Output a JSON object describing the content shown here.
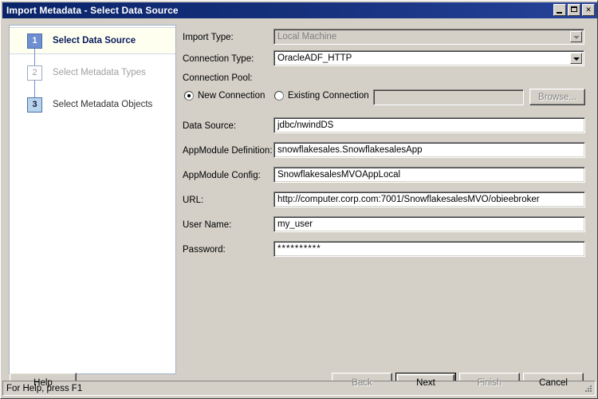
{
  "window": {
    "title": "Import Metadata - Select Data Source",
    "minimize_label": "Minimize",
    "maximize_label": "Maximize",
    "close_label": "✕"
  },
  "steps": [
    {
      "number": "1",
      "label": "Select Data Source",
      "state": "active"
    },
    {
      "number": "2",
      "label": "Select Metadata Types",
      "state": "disabled"
    },
    {
      "number": "3",
      "label": "Select Metadata Objects",
      "state": "pending"
    }
  ],
  "form": {
    "import_type": {
      "label": "Import Type:",
      "value": "Local Machine",
      "enabled": false
    },
    "connection_type": {
      "label": "Connection Type:",
      "value": "OracleADF_HTTP",
      "enabled": true
    },
    "connection_pool": {
      "label": "Connection Pool:",
      "new_connection_label": "New Connection",
      "existing_connection_label": "Existing Connection",
      "selected": "new",
      "existing_value": "",
      "browse_label": "Browse..."
    },
    "fields": [
      {
        "label": "Data Source:",
        "value": "jdbc/nwindDS"
      },
      {
        "label": "AppModule Definition:",
        "value": "snowflakesales.SnowflakesalesApp"
      },
      {
        "label": "AppModule Config:",
        "value": "SnowflakesalesMVOAppLocal"
      },
      {
        "label": "URL:",
        "value": "http://computer.corp.com:7001/SnowflakesalesMVO/obieebroker"
      },
      {
        "label": "User Name:",
        "value": "my_user"
      },
      {
        "label": "Password:",
        "value": "**********"
      }
    ]
  },
  "buttons": {
    "help": {
      "label": "Help",
      "enabled": true
    },
    "back": {
      "label": "Back",
      "enabled": false
    },
    "next": {
      "label": "Next",
      "enabled": true,
      "default": true
    },
    "finish": {
      "label": "Finish",
      "enabled": false
    },
    "cancel": {
      "label": "Cancel",
      "enabled": true
    }
  },
  "statusbar": {
    "text": "For Help, press F1"
  },
  "colors": {
    "titlebar": "#0a246a",
    "face": "#d4d0c8",
    "active_step_badge": "#6f8fd0",
    "pending_step_badge": "#b8d4ec",
    "active_step_row": "#fffff0",
    "active_step_text": "#0a1b5c"
  }
}
